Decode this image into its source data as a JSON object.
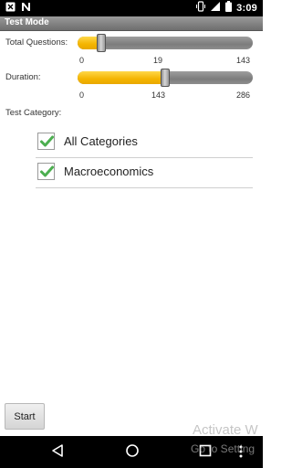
{
  "status_bar": {
    "time": "3:09",
    "icons": [
      "notification-icon",
      "n-app-icon",
      "vibrate-icon",
      "signal-icon",
      "battery-icon"
    ]
  },
  "title_bar": {
    "title": "Test Mode"
  },
  "total_questions": {
    "label": "Total Questions:",
    "min": "0",
    "value": "19",
    "max": "143",
    "fraction": 0.133
  },
  "duration": {
    "label": "Duration:",
    "min": "0",
    "value": "143",
    "max": "286",
    "fraction": 0.5
  },
  "test_category": {
    "label": "Test Category:",
    "items": [
      {
        "label": "All Categories",
        "checked": true
      },
      {
        "label": "Macroeconomics",
        "checked": true
      }
    ]
  },
  "start_button": {
    "label": "Start"
  },
  "watermark": {
    "line1": "Activate W",
    "line2": "Go to Setting"
  },
  "nav_bar": {
    "icons": [
      "back-icon",
      "home-icon",
      "recents-icon"
    ]
  },
  "colors": {
    "slider_fill": "#f4b400",
    "check": "#4caf50",
    "title_bar": "#7a7a7a"
  }
}
